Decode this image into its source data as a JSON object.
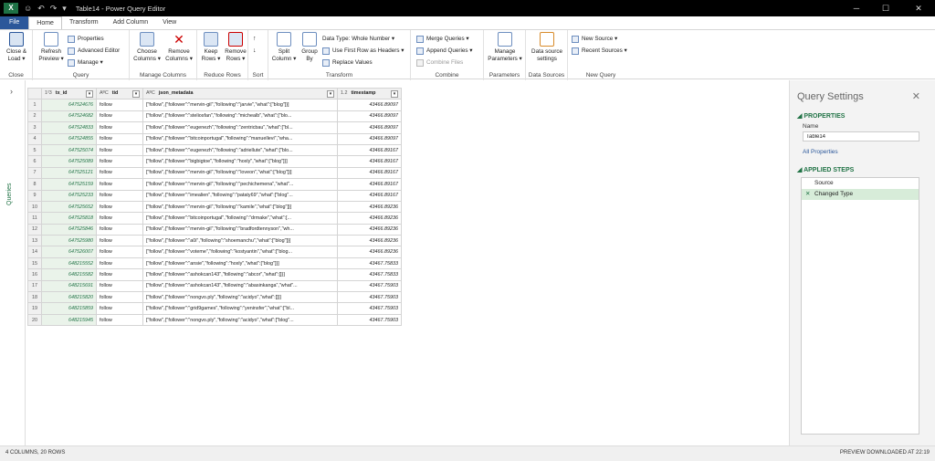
{
  "titlebar": {
    "title": "Table14 - Power Query Editor",
    "icon": "excel-icon"
  },
  "tabs": [
    "File",
    "Home",
    "Transform",
    "Add Column",
    "View"
  ],
  "ribbon": {
    "close": {
      "btn1": "Close &",
      "btn2": "Load ▾",
      "group": "Close"
    },
    "query": {
      "refresh1": "Refresh",
      "refresh2": "Preview ▾",
      "properties": "Properties",
      "advanced": "Advanced Editor",
      "manage": "Manage ▾",
      "group": "Query"
    },
    "manage_cols": {
      "choose1": "Choose",
      "choose2": "Columns ▾",
      "remove1": "Remove",
      "remove2": "Columns ▾",
      "group": "Manage Columns"
    },
    "reduce": {
      "keep1": "Keep",
      "keep2": "Rows ▾",
      "remove1": "Remove",
      "remove2": "Rows ▾",
      "group": "Reduce Rows"
    },
    "sort": {
      "group": "Sort"
    },
    "transform": {
      "split1": "Split",
      "split2": "Column ▾",
      "group1": "Group",
      "group2": "By",
      "datatype": "Data Type: Whole Number ▾",
      "firstrow": "Use First Row as Headers ▾",
      "replace": "Replace Values",
      "group": "Transform"
    },
    "combine": {
      "merge": "Merge Queries ▾",
      "append": "Append Queries ▾",
      "combine_files": "Combine Files",
      "group": "Combine"
    },
    "params": {
      "btn1": "Manage",
      "btn2": "Parameters ▾",
      "group": "Parameters"
    },
    "datasources": {
      "btn1": "Data source",
      "btn2": "settings",
      "group": "Data Sources"
    },
    "newquery": {
      "newsource": "New Source ▾",
      "recent": "Recent Sources ▾",
      "group": "New Query"
    }
  },
  "nav": {
    "label": "Queries"
  },
  "grid": {
    "columns": [
      {
        "type": "1²3",
        "name": "tx_id"
      },
      {
        "type": "AᴮC",
        "name": "tid"
      },
      {
        "type": "AᴮC",
        "name": "json_metadata"
      },
      {
        "type": "1.2",
        "name": "timestamp"
      }
    ],
    "rows": [
      [
        "1",
        "647524676",
        "follow",
        "[\"follow\",{\"follower\":\"mervin-gil\",\"following\":\"jarvie\",\"what\":[\"blog\"]}]",
        "43466.89097"
      ],
      [
        "2",
        "647524682",
        "follow",
        "[\"follow\",{\"follower\":\"steliosfan\",\"following\":\"michealb\",\"what\":[\"blo...",
        "43466.89097"
      ],
      [
        "3",
        "647524833",
        "follow",
        "[\"follow\",{\"follower\":\"eugenezh\",\"following\":\"zentricbau\",\"what\":[\"bl...",
        "43466.89097"
      ],
      [
        "4",
        "647524855",
        "follow",
        "[\"follow\",{\"follower\":\"bitcoinportugal\",\"following\":\"manuellevi\",\"wha...",
        "43466.89097"
      ],
      [
        "5",
        "647525074",
        "follow",
        "[\"follow\",{\"follower\":\"eugenezh\",\"following\":\"adriellute\",\"what\":[\"blo...",
        "43466.89167"
      ],
      [
        "6",
        "647525089",
        "follow",
        "[\"follow\",{\"follower\":\"bigbigtoe\",\"following\":\"hoxly\",\"what\":[\"blog\"]}]",
        "43466.89167"
      ],
      [
        "7",
        "647525121",
        "follow",
        "[\"follow\",{\"follower\":\"mervin-gil\",\"following\":\"loveon\",\"what\":[\"blog\"]}]",
        "43466.89167"
      ],
      [
        "8",
        "647525159",
        "follow",
        "[\"follow\",{\"follower\":\"mervin-gil\",\"following\":\"pechichemena\",\"what\"...",
        "43466.89167"
      ],
      [
        "9",
        "647525233",
        "follow",
        "[\"follow\",{\"follower\":\"imealien\",\"following\":\"pataty69\",\"what\":[\"blog\"...",
        "43466.89167"
      ],
      [
        "10",
        "647525652",
        "follow",
        "[\"follow\",{\"follower\":\"mervin-gil\",\"following\":\"kamile\",\"what\":[\"blog\"]}]",
        "43466.89236"
      ],
      [
        "11",
        "647525818",
        "follow",
        "[\"follow\",{\"follower\":\"bitcoinportugal\",\"following\":\"drmake\",\"what\":[...",
        "43466.89236"
      ],
      [
        "12",
        "647525846",
        "follow",
        "[\"follow\",{\"follower\":\"mervin-gil\",\"following\":\"bradfordtennyson\",\"wh...",
        "43466.89236"
      ],
      [
        "13",
        "647525980",
        "follow",
        "[\"follow\",{\"follower\":\"a0i\",\"following\":\"shoemanchu\",\"what\":[\"blog\"]}]",
        "43466.89236"
      ],
      [
        "14",
        "647526007",
        "follow",
        "[\"follow\",{\"follower\":\"voteme\",\"following\":\"kostyantin\",\"what\":[\"blog...",
        "43466.89236"
      ],
      [
        "15",
        "648215552",
        "follow",
        "[\"follow\",{\"follower\":\"ansie\",\"following\":\"hoxly\",\"what\":[\"blog\"]}]",
        "43467.75833"
      ],
      [
        "16",
        "648215582",
        "follow",
        "[\"follow\",{\"follower\":\"ashokcan143\",\"following\":\"abcor\",\"what\":[]}]",
        "43467.75833"
      ],
      [
        "17",
        "648215691",
        "follow",
        "[\"follow\",{\"follower\":\"ashokcan143\",\"following\":\"abasinkanga\",\"what\"...",
        "43467.75903"
      ],
      [
        "18",
        "648215820",
        "follow",
        "[\"follow\",{\"follower\":\"nongvo.ply\",\"following\":\"acidyo\",\"what\":[]}]",
        "43467.75903"
      ],
      [
        "19",
        "648215859",
        "follow",
        "[\"follow\",{\"follower\":\"grid9games\",\"following\":\"yeninsfer\",\"what\":[\"bl...",
        "43467.75903"
      ],
      [
        "20",
        "648215945",
        "follow",
        "[\"follow\",{\"follower\":\"nongvo.ply\",\"following\":\"acidyo\",\"what\":[\"blog\"...",
        "43467.75903"
      ]
    ]
  },
  "settings": {
    "title": "Query Settings",
    "properties": "PROPERTIES",
    "name_label": "Name",
    "name_value": "Table14",
    "all_props": "All Properties",
    "applied": "APPLIED STEPS",
    "steps": [
      "Source",
      "Changed Type"
    ]
  },
  "status": {
    "left": "4 COLUMNS, 20 ROWS",
    "right": "PREVIEW DOWNLOADED AT 22:19"
  },
  "colors": {
    "excel_green": "#217346",
    "file_blue": "#2b579a"
  }
}
